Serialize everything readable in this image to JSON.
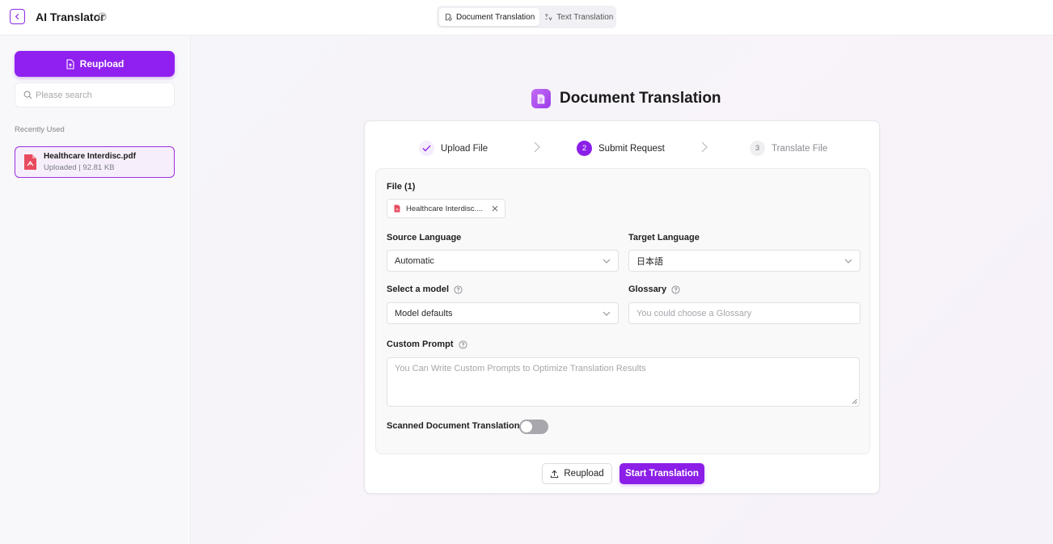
{
  "header": {
    "title": "AI Translator",
    "tabs": [
      {
        "label": "Document Translation",
        "active": true
      },
      {
        "label": "Text Translation",
        "active": false
      }
    ]
  },
  "sidebar": {
    "reupload_label": "Reupload",
    "search_placeholder": "Please search",
    "recent_label": "Recently Used",
    "recent_files": [
      {
        "name": "Healthcare Interdisc.pdf",
        "status": "Uploaded",
        "size": "92.81 KB"
      }
    ]
  },
  "main": {
    "heading": "Document Translation",
    "steps": [
      {
        "label": "Upload File",
        "state": "done"
      },
      {
        "number": "2",
        "label": "Submit Request",
        "state": "current"
      },
      {
        "number": "3",
        "label": "Translate File",
        "state": "pending"
      }
    ],
    "file_label": "File (1)",
    "file_chip": "Healthcare Interdisc....",
    "source_language_label": "Source Language",
    "source_language_value": "Automatic",
    "target_language_label": "Target Language",
    "target_language_value": "日本語",
    "model_label": "Select a model",
    "model_value": "Model defaults",
    "glossary_label": "Glossary",
    "glossary_placeholder": "You could choose a Glossary",
    "custom_prompt_label": "Custom Prompt",
    "custom_prompt_placeholder": "You Can Write Custom Prompts to Optimize Translation Results",
    "scanned_label": "Scanned Document Translation",
    "scanned_enabled": false,
    "reupload_label": "Reupload",
    "start_label": "Start Translation"
  },
  "colors": {
    "accent": "#8b1fe8",
    "pdf": "#e84a5f"
  }
}
